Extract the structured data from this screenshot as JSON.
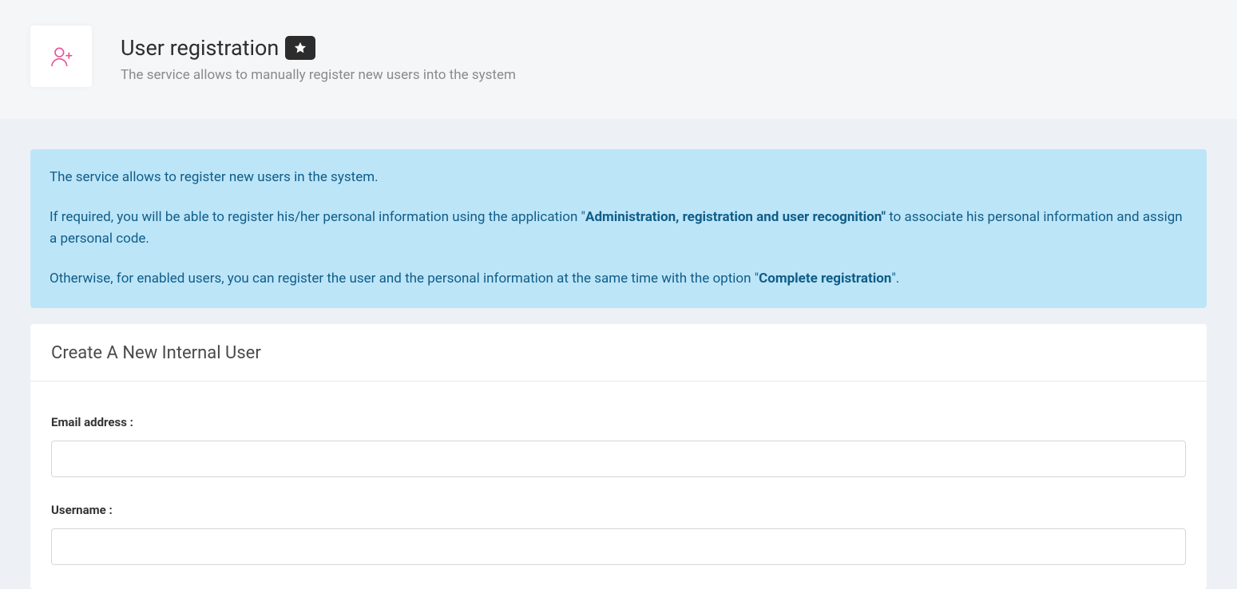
{
  "header": {
    "title": "User registration",
    "subtitle": "The service allows to manually register new users into the system"
  },
  "info": {
    "p1": "The service allows to register new users in the system.",
    "p2_pre": "If required, you will be able to register his/her personal information using the application \"",
    "p2_bold": "Administration, registration and user recognition\"",
    "p2_post": " to associate his personal information and assign a personal code.",
    "p3_pre": "Otherwise, for enabled users, you can register the user and the personal information at the same time with the option \"",
    "p3_bold": "Complete registration",
    "p3_post": "\"."
  },
  "form": {
    "card_title": "Create A New Internal User",
    "email_label": "Email address :",
    "email_value": "",
    "username_label": "Username :",
    "username_value": ""
  }
}
